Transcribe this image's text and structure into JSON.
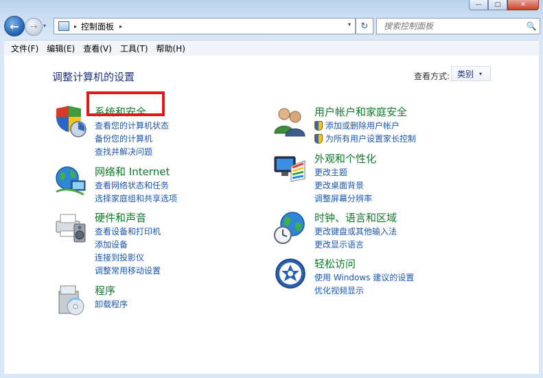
{
  "caption": {
    "min": "—",
    "max": "□",
    "close": "✕"
  },
  "nav": {
    "back": "←",
    "forward": "→",
    "history": "▾"
  },
  "address": {
    "path": "控制面板",
    "sep": "▸",
    "drop": "▾"
  },
  "refresh": "↻",
  "search": {
    "placeholder": "搜索控制面板",
    "icon": "🔍"
  },
  "menu": [
    "文件(F)",
    "编辑(E)",
    "查看(V)",
    "工具(T)",
    "帮助(H)"
  ],
  "page": {
    "title": "调整计算机的设置",
    "view_label": "查看方式:",
    "view_value": "类别",
    "view_drop": "▾"
  },
  "categories_left": [
    {
      "title": "系统和安全",
      "links": [
        "查看您的计算机状态",
        "备份您的计算机",
        "查找并解决问题"
      ]
    },
    {
      "title": "网络和 Internet",
      "links": [
        "查看网络状态和任务",
        "选择家庭组和共享选项"
      ]
    },
    {
      "title": "硬件和声音",
      "links": [
        "查看设备和打印机",
        "添加设备",
        "连接到投影仪",
        "调整常用移动设置"
      ]
    },
    {
      "title": "程序",
      "links": [
        "卸载程序"
      ]
    }
  ],
  "categories_right": [
    {
      "title": "用户帐户和家庭安全",
      "links": [
        "添加或删除用户帐户",
        "为所有用户设置家长控制"
      ]
    },
    {
      "title": "外观和个性化",
      "links": [
        "更改主题",
        "更改桌面背景",
        "调整屏幕分辨率"
      ]
    },
    {
      "title": "时钟、语言和区域",
      "links": [
        "更改键盘或其他输入法",
        "更改显示语言"
      ]
    },
    {
      "title": "轻松访问",
      "links": [
        "使用 Windows 建议的设置",
        "优化视频显示"
      ]
    }
  ],
  "colors": {
    "title_green": "#0e7a2a",
    "link_blue": "#1c56b0",
    "highlight_red": "#e8141c"
  }
}
